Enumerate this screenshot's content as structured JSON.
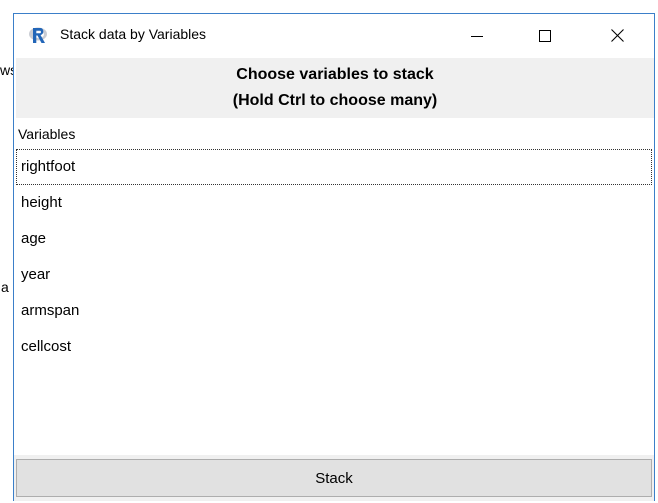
{
  "background": {
    "fragment_1": "ws",
    "fragment_2": "a"
  },
  "window": {
    "title": "Stack data by Variables",
    "icon": "r-logo-icon",
    "controls": {
      "minimize": "minimize-icon",
      "maximize": "maximize-icon",
      "close": "close-icon"
    }
  },
  "header": {
    "line1": "Choose variables to stack",
    "line2": "(Hold Ctrl to choose many)"
  },
  "list": {
    "column_header": "Variables",
    "items": [
      "rightfoot",
      "height",
      "age",
      "year",
      "armspan",
      "cellcost"
    ],
    "focused_index": 0
  },
  "actions": {
    "stack_label": "Stack"
  },
  "colors": {
    "window_border": "#3b7fc9",
    "header_bg": "#f0f0f0",
    "button_bg": "#e1e1e1",
    "r_logo_blue": "#2266b8"
  }
}
